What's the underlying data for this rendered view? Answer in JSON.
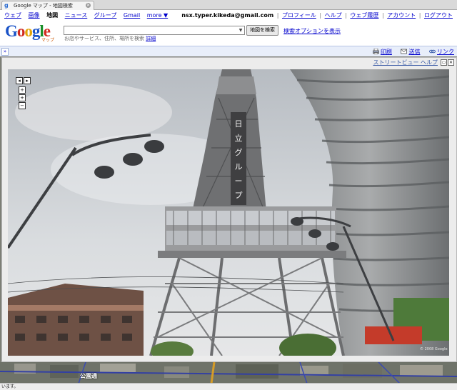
{
  "browser": {
    "tab_title": "Google マップ - 地図検索",
    "favicon": "g",
    "close_symbol": "✕"
  },
  "gbar": {
    "links": [
      "ウェブ",
      "画像",
      "地図",
      "ニュース",
      "グループ",
      "Gmail",
      "more ▼"
    ],
    "current": "地図",
    "email": "nsx.typer.kikeda@gmail.com",
    "account_links": [
      "プロフィール",
      "ヘルプ",
      "ウェブ履歴",
      "アカウント",
      "ログアウト"
    ]
  },
  "header": {
    "logo_letters": [
      "G",
      "o",
      "o",
      "g",
      "l",
      "e"
    ],
    "logo_sub": "マップ",
    "search_value": "",
    "search_button": "地図を検索",
    "search_options": "検索オプションを表示",
    "hint_text": "お店やサービス、住所、場所を検索",
    "hint_link": "詳細"
  },
  "toolbar": {
    "collapse": "»",
    "print": "印刷",
    "send": "送信",
    "link": "リンク"
  },
  "streetview": {
    "title": "ストリートビュー ヘルプ",
    "restore": "▭",
    "close": "✕",
    "copyright": "© 2008 Google",
    "nav": {
      "up": "▴",
      "down": "▾",
      "left": "◂",
      "right": "▸",
      "zoom_in": "+",
      "zoom_out": "−",
      "mid": "+"
    }
  },
  "map": {
    "label": "公園通"
  },
  "status": {
    "text": "います。"
  },
  "colors": {
    "link": "#0000cc",
    "toolbar_bg": "#e8eefa"
  }
}
